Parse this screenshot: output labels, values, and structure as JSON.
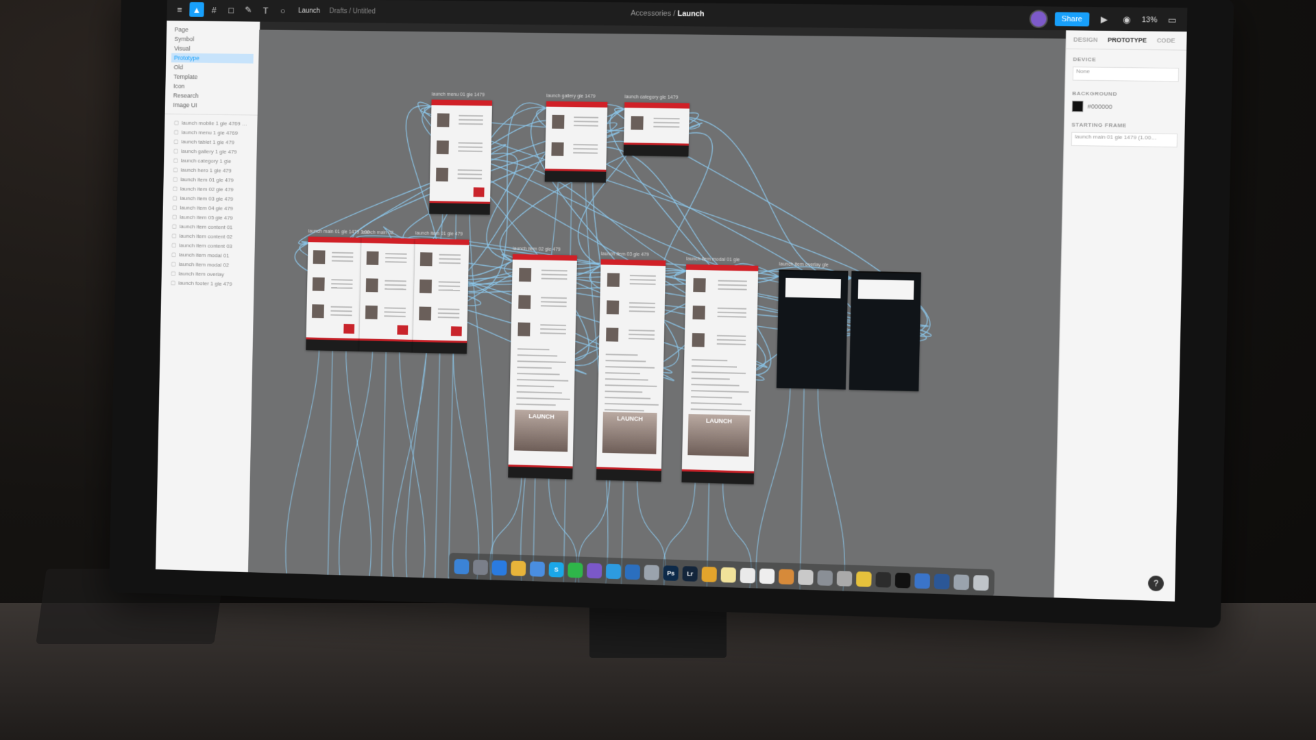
{
  "app": {
    "document_title": "Launch",
    "breadcrumb_prefix": "Accessories",
    "file_tabs": [
      "Launch",
      "Drafts / Untitled"
    ],
    "zoom_label": "13%",
    "share_label": "Share"
  },
  "toolbar": {
    "tools": [
      {
        "icon": "hamburger-menu-icon",
        "glyph": "≡"
      },
      {
        "icon": "move-tool-icon",
        "glyph": "▲",
        "active": true
      },
      {
        "icon": "frame-tool-icon",
        "glyph": "#"
      },
      {
        "icon": "shape-tool-icon",
        "glyph": "□"
      },
      {
        "icon": "pen-tool-icon",
        "glyph": "✎"
      },
      {
        "icon": "text-tool-icon",
        "glyph": "T"
      },
      {
        "icon": "comment-tool-icon",
        "glyph": "○"
      }
    ]
  },
  "layers_panel": {
    "pages": [
      "Page",
      "Symbol",
      "Visual",
      "Prototype",
      "Old",
      "Template",
      "Icon",
      "Research",
      "Image UI"
    ],
    "selected_page_index": 3,
    "layers": [
      "launch mobile 1 gle 4769 …",
      "launch menu 1 gle 4769",
      "launch tablet 1 gle 479",
      "launch gallery 1 gle 479",
      "launch category 1 gle",
      "launch hero 1 gle 479",
      "launch item 01 gle 479",
      "launch item 02 gle 479",
      "launch item 03 gle 479",
      "launch item 04 gle 479",
      "launch item 05 gle 479",
      "launch item content 01",
      "launch item content 02",
      "launch item content 03",
      "launch item modal 01",
      "launch item modal 02",
      "launch item overlay",
      "launch footer 1 gle 479"
    ]
  },
  "properties_panel": {
    "tabs": [
      "DESIGN",
      "PROTOTYPE",
      "CODE"
    ],
    "active_tab_index": 1,
    "device_heading": "DEVICE",
    "device_value": "None",
    "background_heading": "BACKGROUND",
    "background_value": "#000000",
    "background_color": "#111111",
    "starting_frame_heading": "STARTING FRAME",
    "starting_frame_value": "launch main 01 gle 1479 (1.00…"
  },
  "canvas": {
    "frame_labels": [
      "launch menu 01 gle 1479",
      "launch gallery gle 1479",
      "launch category gle 1479",
      "launch main 01 gle 1479 1:00",
      "launch main 02",
      "launch item 01 gle 479",
      "launch item 02 gle 479",
      "launch item 03 gle 479",
      "launch item modal 01 gle",
      "launch item overlay gle"
    ],
    "photo_caption": "LAUNCH",
    "connector_color": "#8cc8ec"
  },
  "dock": {
    "apps": [
      {
        "icon": "finder-icon",
        "label": "",
        "color": "#3b83d6"
      },
      {
        "icon": "launchpad-icon",
        "label": "",
        "color": "#7a7f8a"
      },
      {
        "icon": "safari-icon",
        "label": "",
        "color": "#2a7be0"
      },
      {
        "icon": "chrome-icon",
        "label": "",
        "color": "#e8b43a"
      },
      {
        "icon": "mail-icon",
        "label": "",
        "color": "#4a8ee0"
      },
      {
        "icon": "skype-icon",
        "label": "S",
        "color": "#1ba7e8"
      },
      {
        "icon": "whatsapp-icon",
        "label": "",
        "color": "#2fb64a"
      },
      {
        "icon": "viber-icon",
        "label": "",
        "color": "#7b58c9"
      },
      {
        "icon": "telegram-icon",
        "label": "",
        "color": "#2d9be0"
      },
      {
        "icon": "trello-icon",
        "label": "",
        "color": "#2b6fbf"
      },
      {
        "icon": "preview-icon",
        "label": "",
        "color": "#9aa3ad"
      },
      {
        "icon": "photoshop-icon",
        "label": "Ps",
        "color": "#0d2a49"
      },
      {
        "icon": "lightroom-icon",
        "label": "Lr",
        "color": "#13253b"
      },
      {
        "icon": "sketch-icon",
        "label": "",
        "color": "#e3a42c"
      },
      {
        "icon": "notes-icon",
        "label": "",
        "color": "#f1e29a"
      },
      {
        "icon": "documents-icon",
        "label": "",
        "color": "#eaeaea"
      },
      {
        "icon": "calendar-icon",
        "label": "",
        "color": "#eeeeee"
      },
      {
        "icon": "photos-icon",
        "label": "",
        "color": "#d68a3a"
      },
      {
        "icon": "contacts-icon",
        "label": "",
        "color": "#c9c9c9"
      },
      {
        "icon": "system-prefs-icon",
        "label": "",
        "color": "#8a8f96"
      },
      {
        "icon": "keychain-icon",
        "label": "",
        "color": "#aaaaaa"
      },
      {
        "icon": "cyberduck-icon",
        "label": "",
        "color": "#e6c13c"
      },
      {
        "icon": "figma-icon",
        "label": "",
        "color": "#2c2c2c"
      },
      {
        "icon": "terminal-icon",
        "label": "",
        "color": "#111111"
      },
      {
        "icon": "xcode-icon",
        "label": "",
        "color": "#3a74c9"
      },
      {
        "icon": "word-icon",
        "label": "",
        "color": "#2b5797"
      },
      {
        "icon": "downloads-icon",
        "label": "",
        "color": "#9aa3ad"
      },
      {
        "icon": "trash-icon",
        "label": "",
        "color": "#bfc4c9"
      }
    ]
  }
}
